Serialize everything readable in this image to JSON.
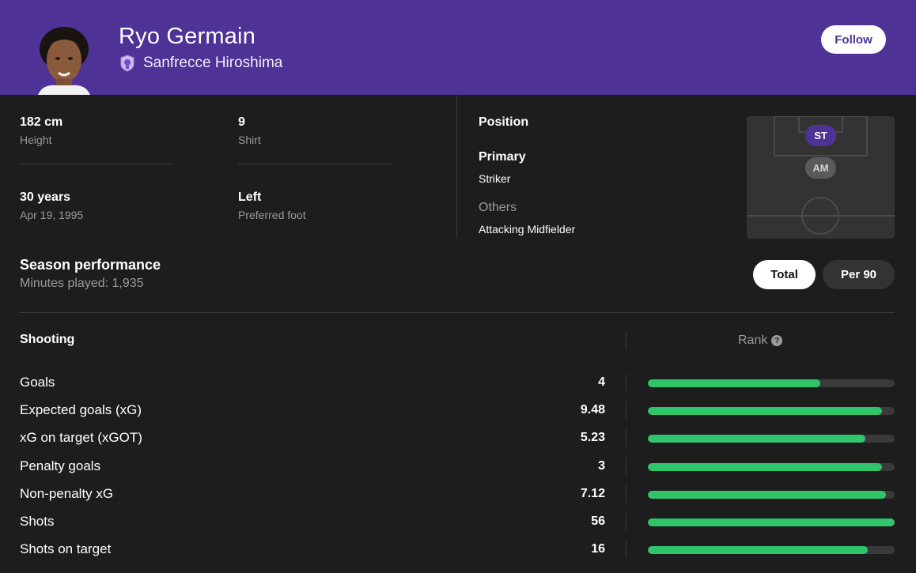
{
  "colors": {
    "header_bg": "#4e3295",
    "accent": "#4e3295",
    "bar_fill": "#30c56b",
    "bar_track": "#3a3a3a",
    "page_bg": "#1d1d1d"
  },
  "player": {
    "name": "Ryo Germain",
    "team": "Sanfrecce Hiroshima",
    "follow_label": "Follow"
  },
  "info": {
    "height_value": "182 cm",
    "height_label": "Height",
    "shirt_value": "9",
    "shirt_label": "Shirt",
    "age_value": "30 years",
    "age_label": "Apr 19, 1995",
    "foot_value": "Left",
    "foot_label": "Preferred foot"
  },
  "position": {
    "title": "Position",
    "primary_label": "Primary",
    "primary_value": "Striker",
    "others_label": "Others",
    "others_value": "Attacking Midfielder",
    "pitch_primary": "ST",
    "pitch_other": "AM"
  },
  "season": {
    "title": "Season performance",
    "subtitle": "Minutes played: 1,935",
    "toggle_total": "Total",
    "toggle_per90": "Per 90"
  },
  "shooting": {
    "title": "Shooting",
    "rank_label": "Rank",
    "help_symbol": "?",
    "stats": [
      {
        "name": "Goals",
        "value": "4",
        "rank_fraction": 0.7
      },
      {
        "name": "Expected goals (xG)",
        "value": "9.48",
        "rank_fraction": 0.95
      },
      {
        "name": "xG on target (xGOT)",
        "value": "5.23",
        "rank_fraction": 0.88
      },
      {
        "name": "Penalty goals",
        "value": "3",
        "rank_fraction": 0.95
      },
      {
        "name": "Non-penalty xG",
        "value": "7.12",
        "rank_fraction": 0.965
      },
      {
        "name": "Shots",
        "value": "56",
        "rank_fraction": 1.0
      },
      {
        "name": "Shots on target",
        "value": "16",
        "rank_fraction": 0.89
      }
    ]
  }
}
